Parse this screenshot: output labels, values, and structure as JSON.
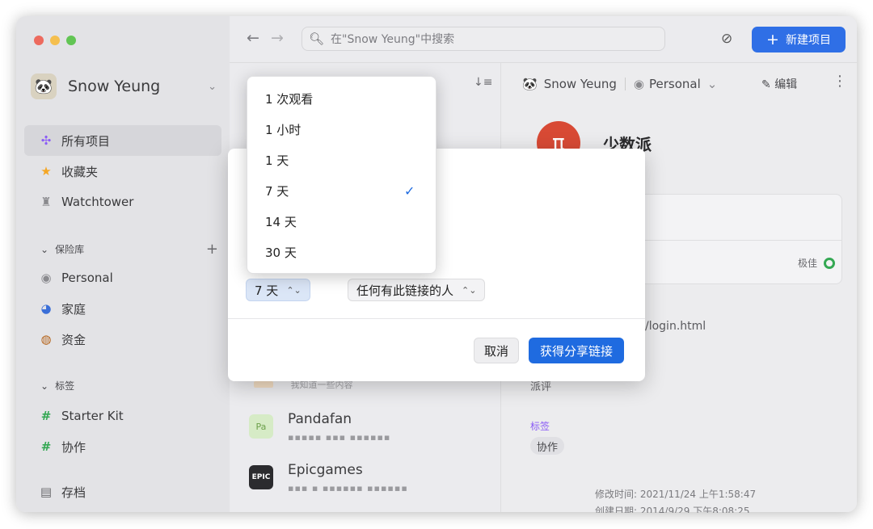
{
  "sidebar": {
    "account_name": "Snow Yeung",
    "items": [
      {
        "label": "所有项目",
        "icon": "grid-icon",
        "color": "#8b5cf6"
      },
      {
        "label": "收藏夹",
        "icon": "star-icon",
        "color": "#f5a623"
      },
      {
        "label": "Watchtower",
        "icon": "tower-icon",
        "color": "#8a8a8e"
      }
    ],
    "vault_section": "保险库",
    "vaults": [
      {
        "label": "Personal",
        "icon": "vault-icon"
      },
      {
        "label": "家庭",
        "icon": "family-vault-icon"
      },
      {
        "label": "资金",
        "icon": "money-vault-icon"
      }
    ],
    "tags_section": "标签",
    "tags": [
      {
        "label": "Starter Kit"
      },
      {
        "label": "协作"
      }
    ],
    "archive_label": "存档"
  },
  "topbar": {
    "search_placeholder": "在\"Snow Yeung\"中搜索",
    "new_item_label": "新建项目"
  },
  "list": {
    "faded_sub": "我知道一些内容",
    "items": [
      {
        "title": "Pandafan",
        "badge": "Pa",
        "sub": "▪▪▪▪▪ ▪▪▪ ▪▪▪▪▪▪"
      },
      {
        "title": "Epicgames",
        "badge": "EPIC",
        "sub": "▪▪▪ ▪ ▪▪▪▪▪▪ ▪▪▪▪▪▪"
      }
    ]
  },
  "detail": {
    "account": "Snow Yeung",
    "vault": "Personal",
    "edit_label": "编辑",
    "title": "少数派",
    "logo_glyph": "π",
    "strength_label": "极佳",
    "url_fragment": "/login.html",
    "faded_label": "派评",
    "tags_label": "标签",
    "tag": "协作",
    "modified": "修改时间: 2021/11/24 上午1:58:47",
    "created": "创建日期: 2014/9/29 下午8:08:25"
  },
  "dialog": {
    "expiry_value": "7 天",
    "access_value": "任何有此链接的人",
    "cancel_label": "取消",
    "primary_label": "获得分享链接"
  },
  "menu": {
    "options": [
      "1 次观看",
      "1 小时",
      "1 天",
      "7 天",
      "14 天",
      "30 天"
    ],
    "selected": "7 天"
  },
  "colors": {
    "accent": "#1f6be0",
    "logo": "#d84a35",
    "strength": "#34a853"
  }
}
